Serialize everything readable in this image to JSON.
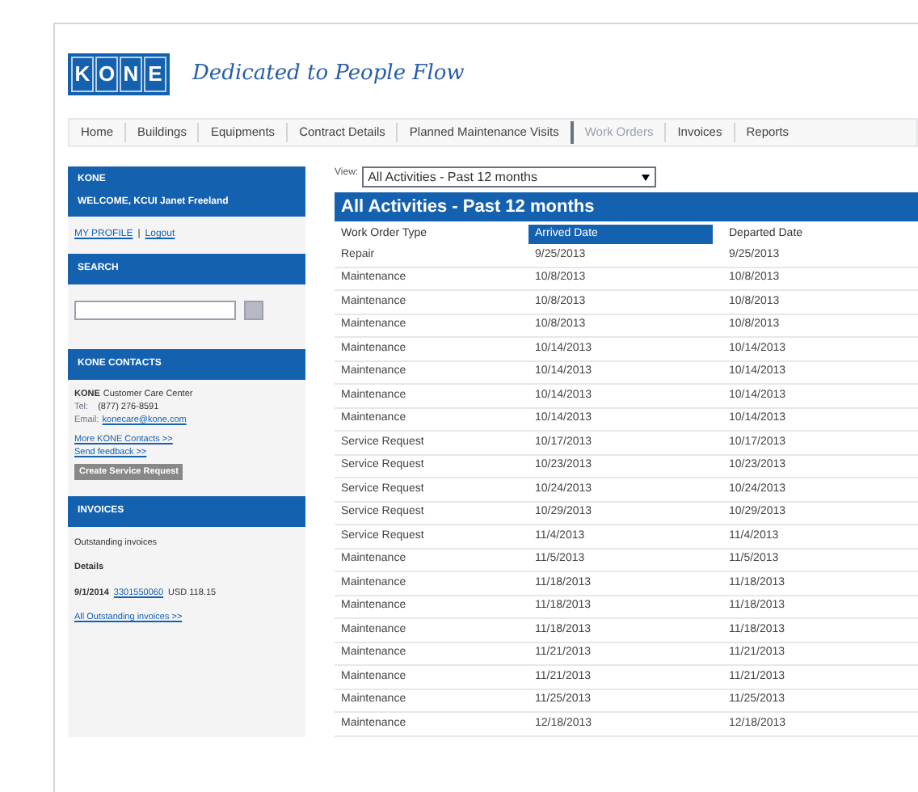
{
  "header": {
    "logo_letters": [
      "K",
      "O",
      "N",
      "E"
    ],
    "tagline": "Dedicated to People Flow"
  },
  "nav": [
    {
      "label": "Home",
      "selected": false
    },
    {
      "label": "Buildings",
      "selected": false
    },
    {
      "label": "Equipments",
      "selected": false
    },
    {
      "label": "Contract Details",
      "selected": false
    },
    {
      "label": "Planned Maintenance Visits",
      "selected": false
    },
    {
      "label": "Work Orders",
      "selected": true
    },
    {
      "label": "Invoices",
      "selected": false
    },
    {
      "label": "Reports",
      "selected": false
    }
  ],
  "sidebar": {
    "account": {
      "title": "KONE",
      "welcome": "WELCOME, KCUI Janet Freeland",
      "profile_link": "MY PROFILE",
      "separator": "|",
      "logout_link": "Logout"
    },
    "search": {
      "title": "SEARCH"
    },
    "contacts": {
      "title": "KONE CONTACTS",
      "company": "KONE",
      "center": "Customer Care Center",
      "tel_label": "Tel:",
      "tel": "(877) 276-8591",
      "email_label": "Email:",
      "email": "konecare@kone.com",
      "more_link": "More KONE Contacts >>",
      "feedback_link": "Send feedback >>",
      "button": "Create Service Request"
    },
    "invoices": {
      "title": "INVOICES",
      "subtitle": "Outstanding invoices",
      "details": "Details",
      "date": "9/1/2014",
      "number": "3301550060",
      "amount": "USD 118.15",
      "all_link": "All Outstanding invoices >>"
    }
  },
  "view": {
    "label": "View:",
    "value": "All Activities - Past 12 months"
  },
  "table": {
    "title": "All Activities - Past 12 months",
    "columns": [
      {
        "label": "Work Order Type",
        "selected": false
      },
      {
        "label": "Arrived Date",
        "selected": true
      },
      {
        "label": "Departed Date",
        "selected": false
      }
    ],
    "rows": [
      [
        "Repair",
        "9/25/2013",
        "9/25/2013"
      ],
      [
        "Maintenance",
        "10/8/2013",
        "10/8/2013"
      ],
      [
        "Maintenance",
        "10/8/2013",
        "10/8/2013"
      ],
      [
        "Maintenance",
        "10/8/2013",
        "10/8/2013"
      ],
      [
        "Maintenance",
        "10/14/2013",
        "10/14/2013"
      ],
      [
        "Maintenance",
        "10/14/2013",
        "10/14/2013"
      ],
      [
        "Maintenance",
        "10/14/2013",
        "10/14/2013"
      ],
      [
        "Maintenance",
        "10/14/2013",
        "10/14/2013"
      ],
      [
        "Service Request",
        "10/17/2013",
        "10/17/2013"
      ],
      [
        "Service Request",
        "10/23/2013",
        "10/23/2013"
      ],
      [
        "Service Request",
        "10/24/2013",
        "10/24/2013"
      ],
      [
        "Service Request",
        "10/29/2013",
        "10/29/2013"
      ],
      [
        "Service Request",
        "11/4/2013",
        "11/4/2013"
      ],
      [
        "Maintenance",
        "11/5/2013",
        "11/5/2013"
      ],
      [
        "Maintenance",
        "11/18/2013",
        "11/18/2013"
      ],
      [
        "Maintenance",
        "11/18/2013",
        "11/18/2013"
      ],
      [
        "Maintenance",
        "11/18/2013",
        "11/18/2013"
      ],
      [
        "Maintenance",
        "11/21/2013",
        "11/21/2013"
      ],
      [
        "Maintenance",
        "11/21/2013",
        "11/21/2013"
      ],
      [
        "Maintenance",
        "11/25/2013",
        "11/25/2013"
      ],
      [
        "Maintenance",
        "12/18/2013",
        "12/18/2013"
      ]
    ]
  }
}
